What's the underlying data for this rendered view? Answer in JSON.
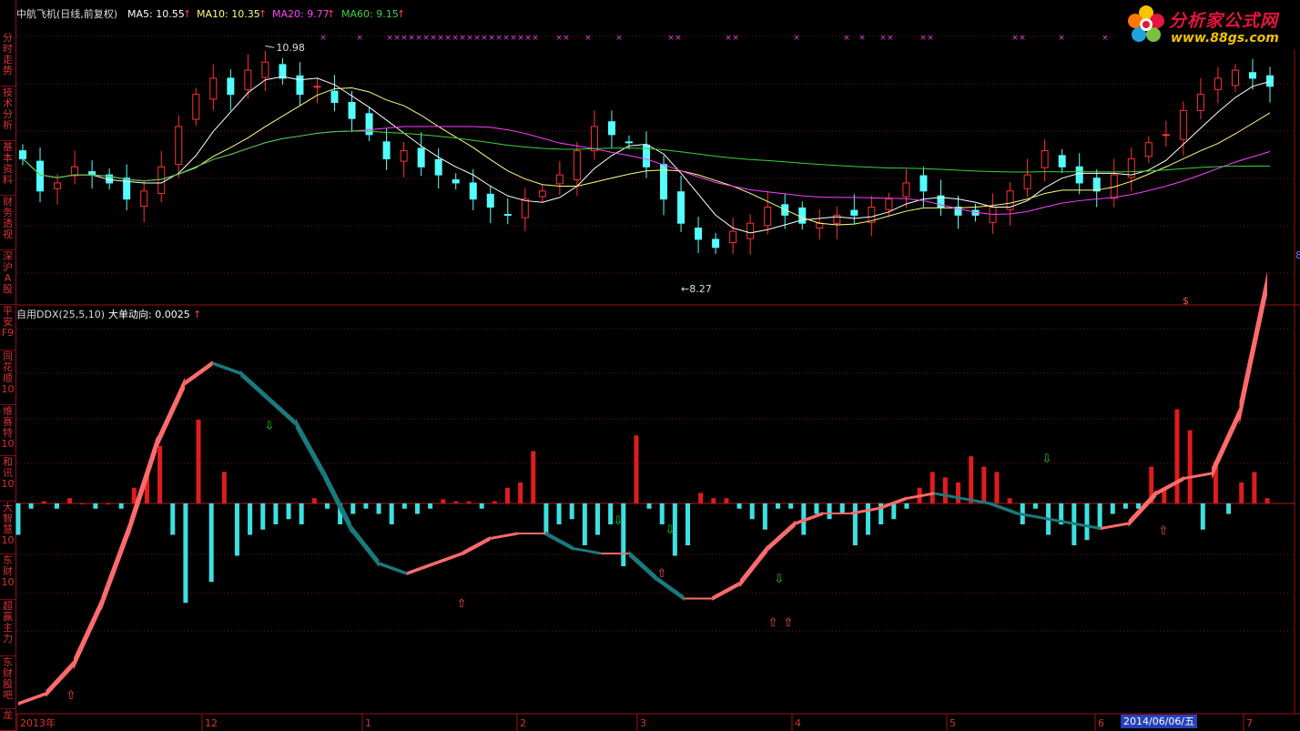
{
  "sidebar": {
    "items": [
      {
        "label": "分时走势"
      },
      {
        "label": "技术分析"
      },
      {
        "label": "基本资料"
      },
      {
        "label": "财务透视"
      },
      {
        "label": "深沪A股"
      },
      {
        "label": "平安F9"
      },
      {
        "label": "同花顺10"
      },
      {
        "label": "维赛特10"
      },
      {
        "label": "和讯10"
      },
      {
        "label": "大智慧10"
      },
      {
        "label": "东财10"
      },
      {
        "label": "超赢主力"
      },
      {
        "label": "东财股吧"
      },
      {
        "label": "龙"
      }
    ]
  },
  "header": {
    "stock_title": "中航飞机(日线,前复权)",
    "ma5": "MA5: 10.55",
    "ma10": "MA10: 10.35",
    "ma20": "MA20: 9.77",
    "ma60": "MA60: 9.15",
    "arrow": "↑"
  },
  "indicator_header": {
    "title": "自用DDX(25,5,10)",
    "value": "大单动向: 0.0025",
    "arrow": "↑"
  },
  "price_labels": {
    "high": "10.98",
    "low": "8.27",
    "right_mark": "8",
    "s_mark": "$"
  },
  "x_axis": {
    "labels": [
      "2013年",
      "12",
      "1",
      "2",
      "3",
      "4",
      "5",
      "6",
      "7"
    ]
  },
  "date_badge": "2014/06/06/五",
  "logo": {
    "main": "分析家公式网",
    "sub": "www.88gs.com"
  },
  "colors": {
    "up": "#ff3232",
    "down": "#54ffff",
    "ma5": "#ffffff",
    "ma10": "#ffff7c",
    "ma20": "#ff40ff",
    "ma60": "#3cd23c",
    "ribbon_up": "#ff6b6b",
    "ribbon_down": "#1a7a7e",
    "marker_x": "#e040e0",
    "arrow_up": "#ff4d4d",
    "arrow_down": "#20d020"
  },
  "chart_data": [
    {
      "type": "candlestick",
      "title": "中航飞机(日线,前复权)",
      "x_ticks": [
        "2013年",
        "12",
        "1",
        "2",
        "3",
        "4",
        "5",
        "6",
        "7"
      ],
      "annotations": [
        "10.98",
        "8.27"
      ],
      "series": [
        {
          "name": "K线",
          "ohlc_close_approx": [
            9.6,
            9.2,
            9.3,
            9.5,
            9.4,
            9.3,
            9.1,
            9.2,
            9.5,
            10.0,
            10.4,
            10.6,
            10.4,
            10.7,
            10.8,
            10.6,
            10.4,
            10.5,
            10.3,
            10.1,
            9.9,
            9.6,
            9.7,
            9.5,
            9.4,
            9.3,
            9.1,
            9.0,
            8.9,
            9.1,
            9.2,
            9.4,
            9.7,
            10.0,
            9.9,
            9.8,
            9.5,
            9.1,
            8.8,
            8.6,
            8.5,
            8.7,
            8.8,
            9.0,
            8.9,
            8.8,
            8.8,
            8.9,
            8.9,
            9.0,
            9.1,
            9.3,
            9.2,
            9.0,
            8.9,
            8.9,
            9.0,
            9.2,
            9.4,
            9.7,
            9.5,
            9.3,
            9.2,
            9.4,
            9.6,
            9.8,
            9.9,
            10.2,
            10.4,
            10.6,
            10.7,
            10.6,
            10.5
          ]
        },
        {
          "name": "MA5",
          "last": 10.55
        },
        {
          "name": "MA10",
          "last": 10.35
        },
        {
          "name": "MA20",
          "last": 9.77
        },
        {
          "name": "MA60",
          "last": 9.15
        }
      ]
    },
    {
      "type": "bar",
      "title": "自用DDX(25,5,10)",
      "series": [
        {
          "name": "大单动向",
          "last": 0.0025,
          "values": [
            -0.3,
            -0.05,
            0.02,
            -0.05,
            0.05,
            0.0,
            -0.05,
            0.0,
            -0.05,
            0.15,
            0.3,
            0.55,
            -0.3,
            -0.95,
            0.8,
            -0.75,
            0.3,
            -0.5,
            -0.3,
            -0.25,
            -0.2,
            -0.15,
            -0.2,
            0.05,
            -0.05,
            -0.2,
            -0.1,
            -0.05,
            -0.1,
            -0.2,
            -0.05,
            -0.1,
            -0.05,
            0.04,
            0.02,
            0.02,
            -0.05,
            0.02,
            0.15,
            0.2,
            0.5,
            -0.3,
            -0.2,
            -0.15,
            -0.4,
            -0.3,
            -0.2,
            -0.6,
            0.65,
            -0.05,
            -0.2,
            -0.5,
            -0.4,
            0.1,
            0.05,
            0.05,
            -0.05,
            -0.15,
            -0.25,
            -0.05,
            -0.05,
            -0.3,
            -0.1,
            -0.15,
            -0.1,
            -0.4,
            -0.3,
            -0.2,
            -0.15,
            -0.05,
            0.15,
            0.3,
            0.25,
            0.2,
            0.45,
            0.35,
            0.3,
            0.05,
            -0.2,
            -0.05,
            -0.3,
            -0.2,
            -0.4,
            -0.35,
            -0.25,
            -0.1,
            -0.05,
            -0.05,
            0.35,
            0.15,
            0.9,
            0.7,
            -0.25,
            0.4,
            -0.1,
            0.2,
            0.3,
            0.05
          ]
        },
        {
          "name": "DDX带",
          "ribbon_approx": [
            -4.0,
            -3.8,
            -3.2,
            -2.0,
            -0.5,
            1.2,
            2.4,
            2.8,
            2.6,
            2.1,
            1.6,
            0.6,
            -0.5,
            -1.2,
            -1.4,
            -1.2,
            -1.0,
            -0.7,
            -0.6,
            -0.6,
            -0.9,
            -1.0,
            -1.0,
            -1.5,
            -1.9,
            -1.9,
            -1.6,
            -0.9,
            -0.4,
            -0.2,
            -0.2,
            -0.1,
            0.1,
            0.2,
            0.1,
            0.0,
            -0.2,
            -0.3,
            -0.4,
            -0.5,
            -0.4,
            0.2,
            0.5,
            0.6,
            1.8,
            4.4
          ]
        }
      ]
    }
  ]
}
